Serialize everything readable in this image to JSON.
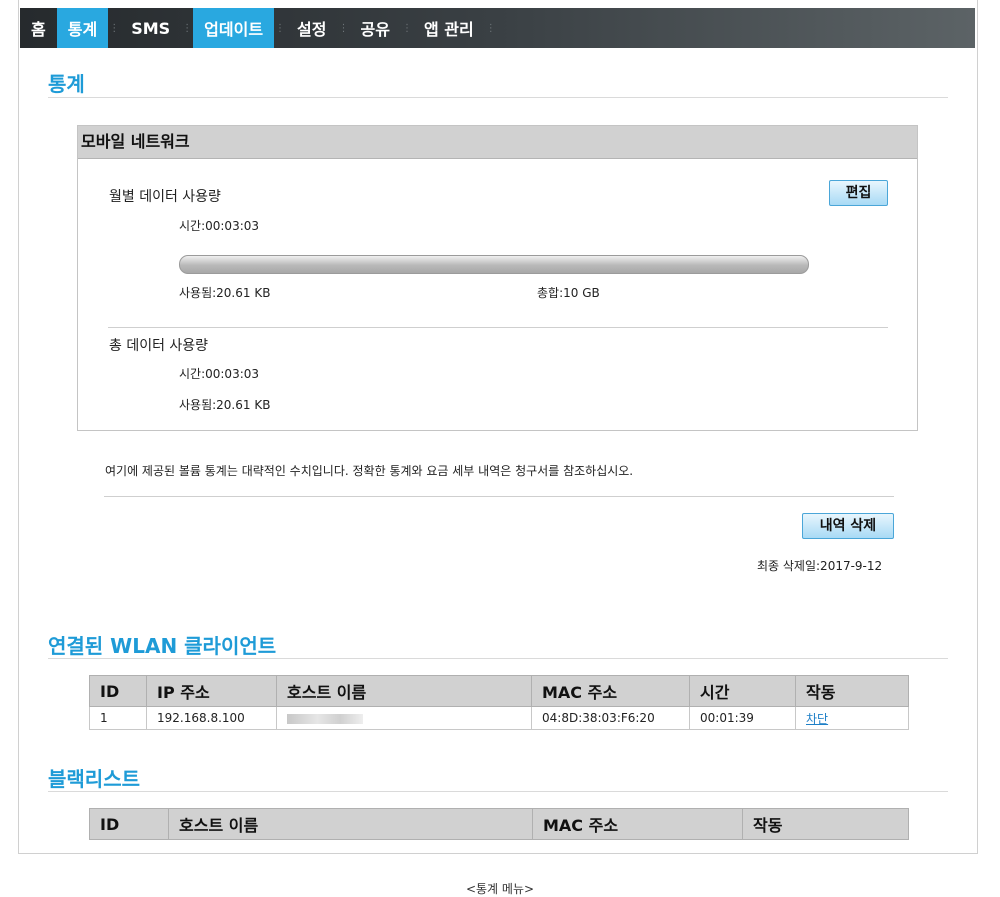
{
  "nav": {
    "items": [
      {
        "label": "홈",
        "active": false
      },
      {
        "label": "통계",
        "active": true
      },
      {
        "label": "SMS",
        "active": false
      },
      {
        "label": "업데이트",
        "active": true
      },
      {
        "label": "설정",
        "active": false
      },
      {
        "label": "공유",
        "active": false
      },
      {
        "label": "앱 관리",
        "active": false
      }
    ]
  },
  "stats": {
    "title": "통계",
    "panel_title": "모바일 네트워크",
    "monthly": {
      "label": "월별 데이터 사용량",
      "edit_button": "편집",
      "time": "시간:00:03:03",
      "used": "사용됨:20.61 KB",
      "total": "총합:10 GB",
      "progress_fraction": 2e-06
    },
    "total": {
      "label": "총 데이터 사용량",
      "time": "시간:00:03:03",
      "used": "사용됨:20.61 KB"
    },
    "notice": "여기에 제공된 볼륨 통계는 대략적인 수치입니다. 정확한 통계와 요금 세부 내역은 청구서를 참조하십시오.",
    "clear_button": "내역 삭제",
    "last_cleared": "최종 삭제일:2017-9-12"
  },
  "wlan": {
    "title": "연결된 WLAN 클라이언트",
    "headers": [
      "ID",
      "IP 주소",
      "호스트 이름",
      "MAC 주소",
      "시간",
      "작동"
    ],
    "rows": [
      {
        "id": "1",
        "ip": "192.168.8.100",
        "host": "",
        "mac": "04:8D:38:03:F6:20",
        "time": "00:01:39",
        "action": "차단"
      }
    ]
  },
  "blacklist": {
    "title": "블랙리스트",
    "headers": [
      "ID",
      "호스트 이름",
      "MAC 주소",
      "작동"
    ]
  },
  "footer": {
    "menu_link": "<통계 메뉴>"
  }
}
